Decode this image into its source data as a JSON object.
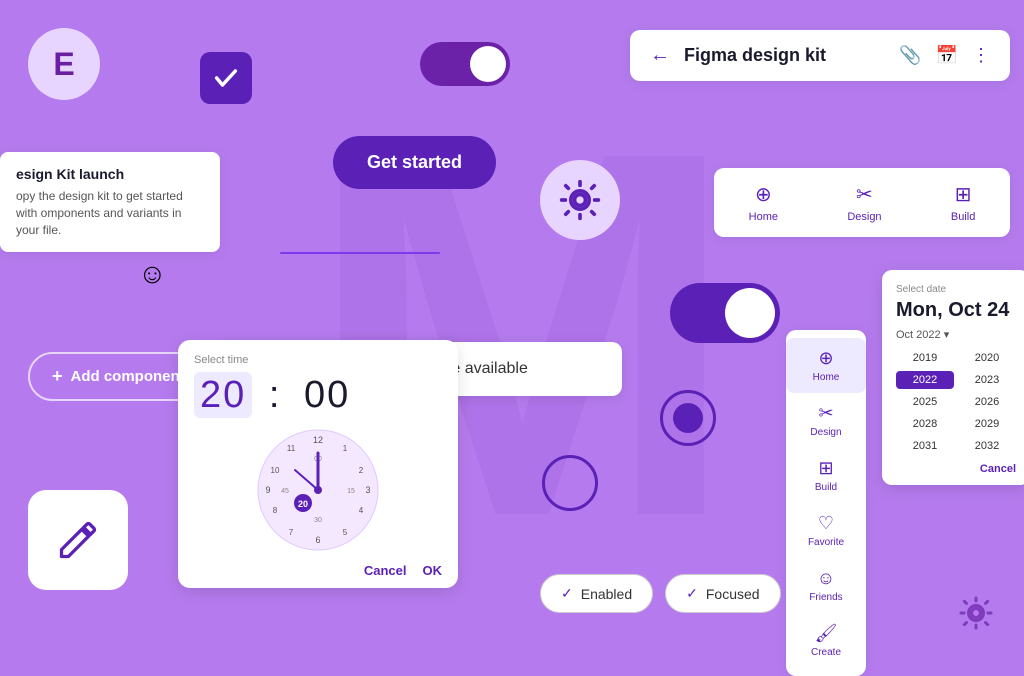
{
  "watermark": {
    "letter": "M"
  },
  "avatar": {
    "letter": "E"
  },
  "checkbox": {
    "checked": true
  },
  "toggle_small": {
    "state": "on"
  },
  "get_started_btn": {
    "label": "Get started"
  },
  "gear_widget": {
    "label": "Settings"
  },
  "desc_card": {
    "title": "esign Kit launch",
    "body": "opy the design kit to get started with omponents and variants in your file."
  },
  "add_component": {
    "label": "Add component"
  },
  "snackbar": {
    "message": "Components update available"
  },
  "time_picker": {
    "label": "Select time",
    "hours": "20",
    "separator": ":",
    "minutes": "00",
    "cancel": "Cancel",
    "ok": "OK"
  },
  "chips": {
    "enabled": {
      "check": "✓",
      "label": "Enabled"
    },
    "focused": {
      "check": "✓",
      "label": "Focused"
    }
  },
  "top_bar": {
    "back": "←",
    "title": "Figma design kit",
    "icons": [
      "📎",
      "📅",
      "⋮"
    ]
  },
  "nav_bar": {
    "items": [
      {
        "icon": "⊕",
        "label": "Home"
      },
      {
        "icon": "✂",
        "label": "Design"
      },
      {
        "icon": "⊞",
        "label": "Build"
      }
    ]
  },
  "sidebar_nav": {
    "items": [
      {
        "icon": "⊕",
        "label": "Home",
        "active": true
      },
      {
        "icon": "✂",
        "label": "Design"
      },
      {
        "icon": "⊞",
        "label": "Build"
      },
      {
        "icon": "♡",
        "label": "Favorite"
      },
      {
        "icon": "☺",
        "label": "Friends"
      },
      {
        "icon": "🖌",
        "label": "Create"
      }
    ]
  },
  "date_picker": {
    "label": "Select date",
    "date": "Mon, Oct 24",
    "month_year": "Oct 2022 ▾",
    "cancel_label": "Cancel",
    "years": [
      {
        "val": "2019"
      },
      {
        "val": "2020"
      },
      {
        "val": "2022",
        "selected": true
      },
      {
        "val": "2023"
      },
      {
        "val": "2025"
      },
      {
        "val": "2026"
      },
      {
        "val": "2028"
      },
      {
        "val": "2029"
      },
      {
        "val": "2031"
      },
      {
        "val": "2032"
      }
    ]
  },
  "edit_icon": {
    "label": "Edit"
  }
}
